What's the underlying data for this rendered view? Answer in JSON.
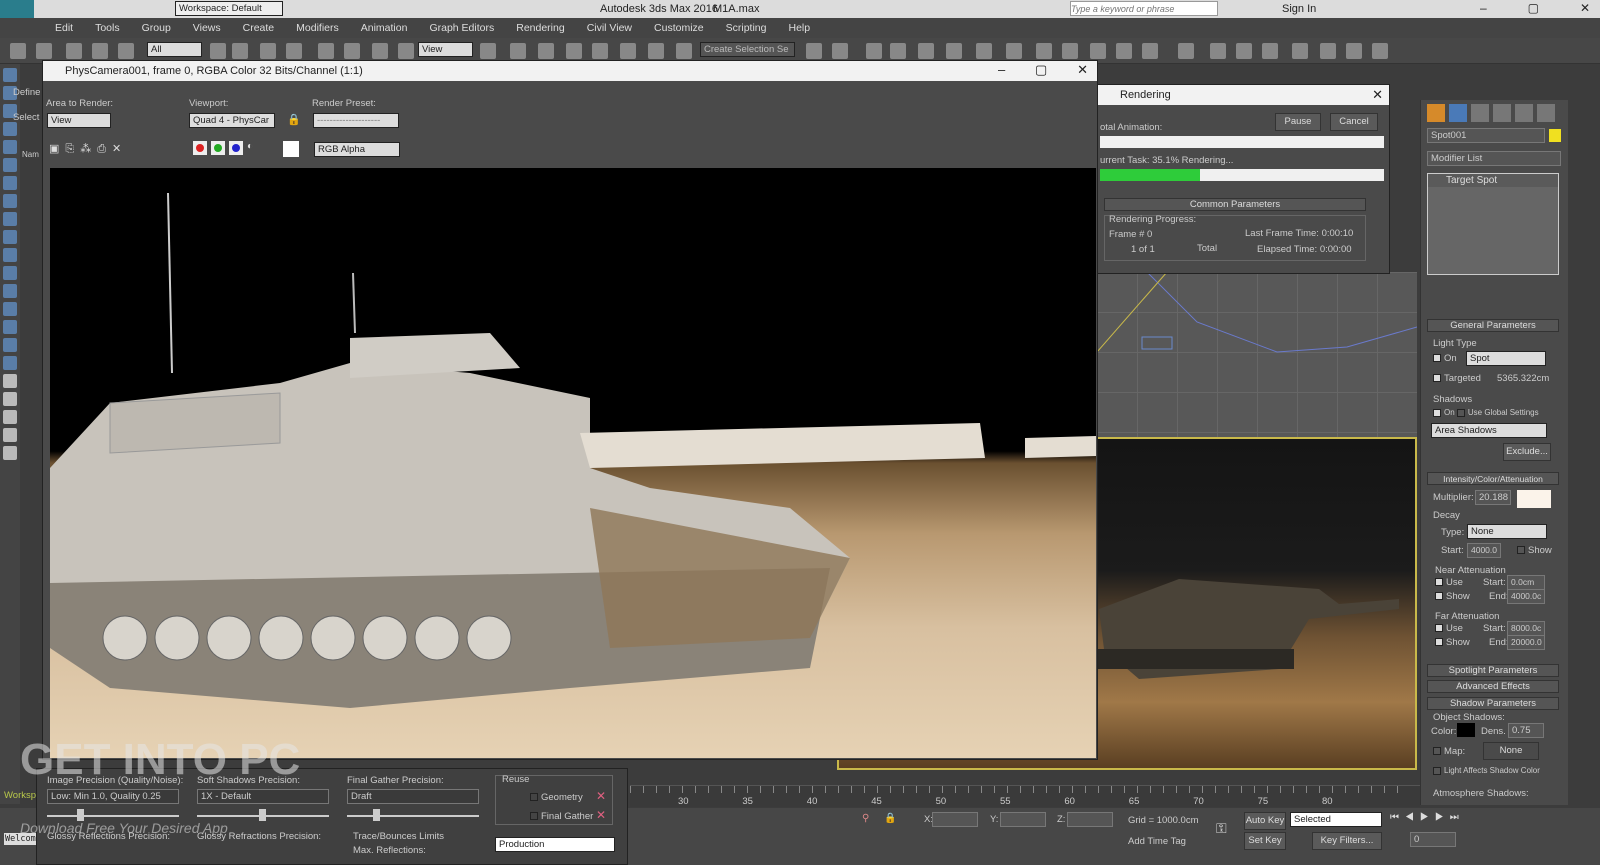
{
  "app": {
    "title": "Autodesk 3ds Max 2016",
    "file": "M1A.max",
    "workspace": "Workspace: Default",
    "search_placeholder": "Type a keyword or phrase",
    "sign_in": "Sign In",
    "logo": "MAX"
  },
  "menu": [
    "Edit",
    "Tools",
    "Group",
    "Views",
    "Create",
    "Modifiers",
    "Animation",
    "Graph Editors",
    "Rendering",
    "Civil View",
    "Customize",
    "Scripting",
    "Help"
  ],
  "toolbar": {
    "filter": "All",
    "ref_coord": "View",
    "selection_set": "Create Selection Se"
  },
  "side_labels": {
    "define": "Define",
    "select": "Select",
    "name": "Nam",
    "workspace": "Worksp",
    "welcome": "Welcom"
  },
  "frame_window": {
    "title": "PhysCamera001, frame 0, RGBA Color 32 Bits/Channel (1:1)",
    "area_label": "Area to Render:",
    "area_value": "View",
    "viewport_label": "Viewport:",
    "viewport_value": "Quad 4 - PhysCar",
    "preset_label": "Render Preset:",
    "preset_value": "--------------------",
    "channel": "RGBA Alpha",
    "channel_display": "RGB Alpha"
  },
  "rendering_dialog": {
    "title": "Rendering",
    "total_label": "otal Animation:",
    "pause": "Pause",
    "cancel": "Cancel",
    "current_task_label": "urrent Task:",
    "current_task": "35.1%  Rendering...",
    "progress_percent": 35.1,
    "section": "Common Parameters",
    "group": "Rendering Progress:",
    "frame_label": "Frame #",
    "frame": "0",
    "of": "1 of 1",
    "total": "Total",
    "last_frame_label": "Last Frame Time:",
    "last_frame": "0:00:10",
    "elapsed_label": "Elapsed Time:",
    "elapsed": "0:00:00"
  },
  "command_panel": {
    "object_name": "Spot001",
    "modifier_list": "Modifier List",
    "stack_item": "Target Spot",
    "general": "General Parameters",
    "light_type": "Light Type",
    "on": "On",
    "type_value": "Spot",
    "targeted": "Targeted",
    "target_dist": "5365.322cm",
    "shadows": "Shadows",
    "use_global": "Use Global Settings",
    "shadow_type": "Area Shadows",
    "exclude": "Exclude...",
    "intensity": "Intensity/Color/Attenuation",
    "multiplier_label": "Multiplier:",
    "multiplier": "20.188",
    "decay": "Decay",
    "decay_type_label": "Type:",
    "decay_type": "None",
    "decay_start_label": "Start:",
    "decay_start": "4000.0",
    "show": "Show",
    "near": "Near Attenuation",
    "use": "Use",
    "start_label": "Start:",
    "end_label": "End:",
    "near_start": "0.0cm",
    "near_end": "4000.0c",
    "far": "Far Attenuation",
    "far_start": "8000.0c",
    "far_end": "20000.0",
    "spotlight": "Spotlight Parameters",
    "advanced": "Advanced Effects",
    "shadow_params": "Shadow Parameters",
    "object_shadows": "Object Shadows:",
    "color_label": "Color:",
    "dens_label": "Dens.",
    "dens": "0.75",
    "map_label": "Map:",
    "map_value": "None",
    "light_affects": "Light Affects Shadow Color",
    "atmosphere": "Atmosphere Shadows:"
  },
  "render_settings": {
    "image_precision_label": "Image Precision (Quality/Noise):",
    "image_precision": "Low: Min 1.0, Quality 0.25",
    "soft_shadows_label": "Soft Shadows Precision:",
    "soft_shadows": "1X - Default",
    "final_gather_label": "Final Gather Precision:",
    "final_gather": "Draft",
    "reuse": "Reuse",
    "geometry": "Geometry",
    "final_gather_chk": "Final Gather",
    "glossy_refl": "Glossy Reflections Precision:",
    "glossy_refr": "Glossy Refractions Precision:",
    "trace_limits": "Trace/Bounces Limits",
    "max_refl": "Max. Reflections:",
    "mode": "Production"
  },
  "timeline": {
    "ticks": [
      "30",
      "35",
      "40",
      "45",
      "50",
      "55",
      "60",
      "65",
      "70",
      "75",
      "80"
    ]
  },
  "status": {
    "x": "X:",
    "y": "Y:",
    "z": "Z:",
    "grid": "Grid = 1000.0cm",
    "add_time_tag": "Add Time Tag",
    "auto_key": "Auto Key",
    "set_key": "Set Key",
    "key_mode": "Selected",
    "key_filters": "Key Filters...",
    "frame": "0"
  },
  "watermark": {
    "main": "GET INTO PC",
    "sub": "Download Free Your Desired App"
  },
  "colors": {
    "progress": "#2ecc3a",
    "ui_dark": "#4a4a4a",
    "titlebar": "#f2f2f2"
  }
}
